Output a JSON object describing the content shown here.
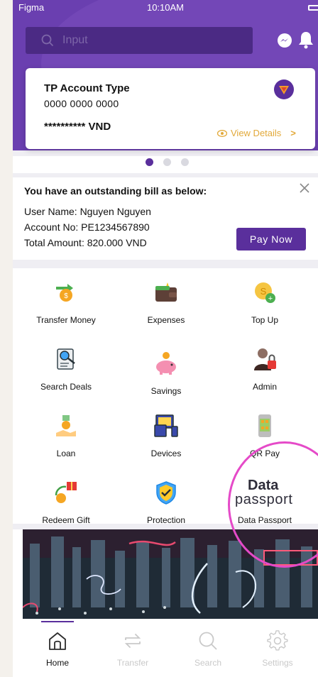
{
  "status": {
    "carrier": "Figma",
    "time": "10:10AM"
  },
  "search": {
    "placeholder": "Input"
  },
  "card": {
    "account_type": "TP Account Type",
    "account_number": "0000 0000 0000",
    "balance": "********** VND",
    "view_details": "View Details",
    "view_chevron": ">"
  },
  "carousel": {
    "total": 3,
    "active": 1
  },
  "bill": {
    "title": "You have an outstanding bill as below:",
    "user_name": "User Name: Nguyen Nguyen",
    "account_no": "Account No: PE1234567890",
    "total_amount": "Total Amount: 820.000 VND",
    "pay_label": "Pay Now"
  },
  "services": [
    {
      "label": "Transfer Money",
      "icon": "transfer-money-icon"
    },
    {
      "label": "Expenses",
      "icon": "wallet-icon"
    },
    {
      "label": "Top Up",
      "icon": "top-up-coin-icon"
    },
    {
      "label": "Search Deals",
      "icon": "search-deals-icon"
    },
    {
      "label": "Savings",
      "icon": "piggy-bank-icon"
    },
    {
      "label": "Admin",
      "icon": "admin-icon"
    },
    {
      "label": "Loan",
      "icon": "loan-icon"
    },
    {
      "label": "Devices",
      "icon": "devices-icon"
    },
    {
      "label": "QR Pay",
      "icon": "qr-pay-icon"
    },
    {
      "label": "Redeem Gift",
      "icon": "gift-icon"
    },
    {
      "label": "Protection",
      "icon": "shield-check-icon"
    },
    {
      "label": "Data Passport",
      "icon": "data-passport-logo"
    }
  ],
  "passport_logo": {
    "word1": "Data",
    "word2": "passport"
  },
  "nav": [
    {
      "label": "Home",
      "active": true
    },
    {
      "label": "Transfer",
      "active": false
    },
    {
      "label": "Search",
      "active": false
    },
    {
      "label": "Settings",
      "active": false
    }
  ],
  "colors": {
    "primary": "#5a2f9c",
    "accent": "#e2a93a",
    "highlight": "#e54ac8"
  }
}
